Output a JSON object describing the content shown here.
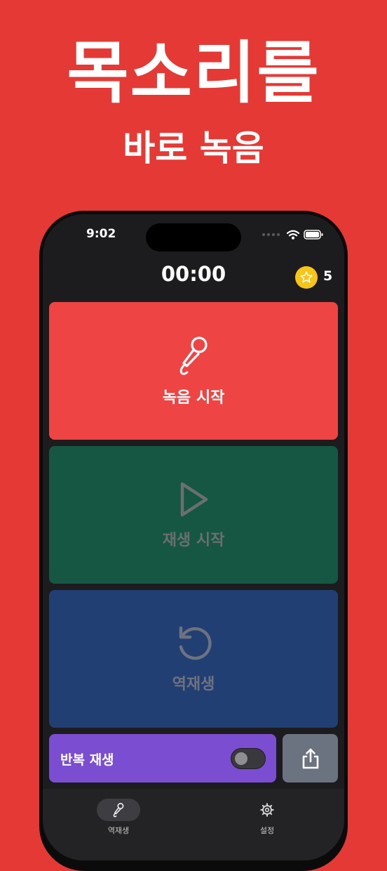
{
  "promo": {
    "headline": "목소리를",
    "subheadline": "바로 녹음"
  },
  "status_bar": {
    "time": "9:02"
  },
  "header": {
    "timer": "00:00",
    "coin_count": "5",
    "coin_icon": "star-icon"
  },
  "cards": {
    "record": {
      "label": "녹음 시작",
      "icon": "microphone-icon",
      "color": "#ef4444"
    },
    "play": {
      "label": "재생 시작",
      "icon": "play-icon",
      "color": "#155743"
    },
    "reverse": {
      "label": "역재생",
      "icon": "rotate-ccw-icon",
      "color": "#223f74"
    }
  },
  "repeat": {
    "label": "반복 재생",
    "enabled": false,
    "color": "#7a4dd1"
  },
  "share": {
    "icon": "share-icon"
  },
  "tabs": [
    {
      "label": "역재생",
      "icon": "microphone-icon",
      "active": true
    },
    {
      "label": "설정",
      "icon": "gear-icon",
      "active": false
    }
  ],
  "colors": {
    "background": "#e53935",
    "screen": "#1c1c1e",
    "coin": "#f7c418"
  }
}
